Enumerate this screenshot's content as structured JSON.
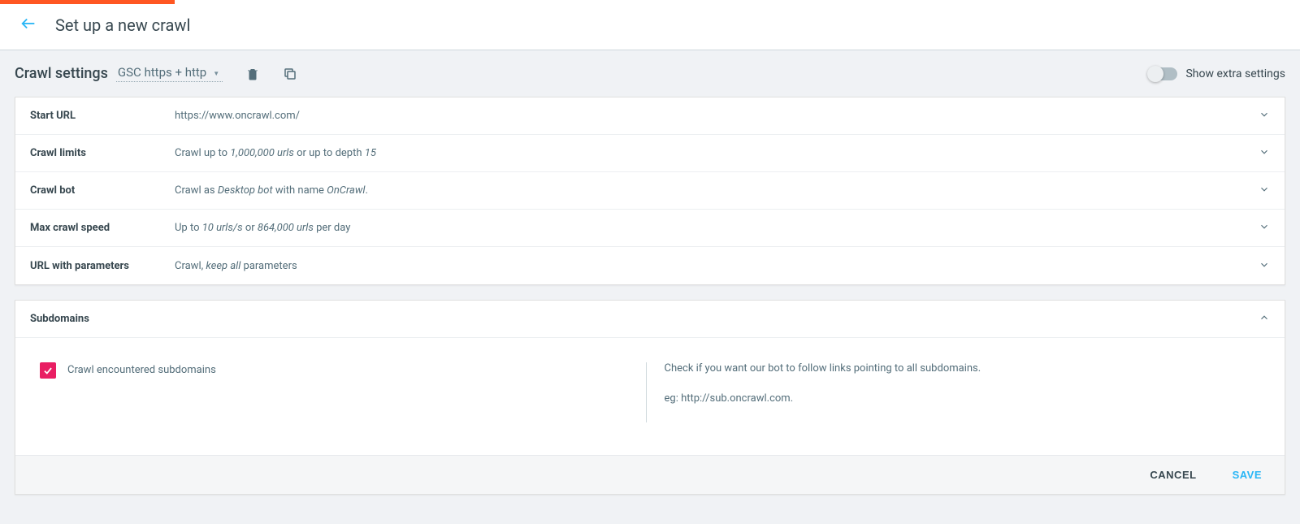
{
  "header": {
    "title": "Set up a new crawl"
  },
  "toolbar": {
    "section_label": "Crawl settings",
    "profile": "GSC https + http",
    "extra_settings_label": "Show extra settings",
    "extra_settings_on": false
  },
  "settings": {
    "start_url": {
      "label": "Start URL",
      "value": "https://www.oncrawl.com/"
    },
    "crawl_limits": {
      "label": "Crawl limits",
      "prefix": "Crawl up to ",
      "urls": "1,000,000 urls",
      "mid": " or up to depth ",
      "depth": "15"
    },
    "crawl_bot": {
      "label": "Crawl bot",
      "prefix": "Crawl as ",
      "bot_type": "Desktop bot",
      "mid": " with name ",
      "bot_name": "OnCrawl",
      "suffix": "."
    },
    "max_speed": {
      "label": "Max crawl speed",
      "prefix": "Up to ",
      "rate": "10 urls/s",
      "mid": " or ",
      "per_day": "864,000 urls",
      "suffix": " per day"
    },
    "url_params": {
      "label": "URL with parameters",
      "prefix": "Crawl, ",
      "mode": "keep all",
      "suffix": " parameters"
    }
  },
  "subdomains": {
    "label": "Subdomains",
    "checkbox_label": "Crawl encountered subdomains",
    "checked": true,
    "help_line1": "Check if you want our bot to follow links pointing to all subdomains.",
    "help_line2": "eg: http://sub.oncrawl.com."
  },
  "footer": {
    "cancel": "CANCEL",
    "save": "SAVE"
  }
}
